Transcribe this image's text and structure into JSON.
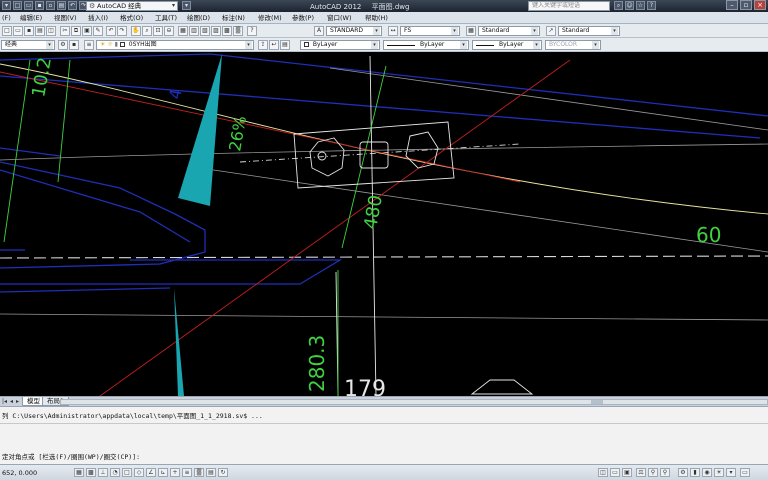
{
  "titlebar": {
    "workspace": "AutoCAD 经典",
    "app_name": "AutoCAD 2012",
    "file_name": "平面图.dwg",
    "search_placeholder": "键入关键字或短语"
  },
  "menu": {
    "items": [
      "(F)",
      "编辑(E)",
      "视图(V)",
      "插入(I)",
      "格式(O)",
      "工具(T)",
      "绘图(D)",
      "标注(N)",
      "修改(M)",
      "参数(P)",
      "窗口(W)",
      "帮助(H)"
    ]
  },
  "toolbar1": {
    "text_style": "STANDARD",
    "dim_style": "FS",
    "table_style": "Standard",
    "mleader_style": "Standard"
  },
  "toolbar2": {
    "workspace": "经典",
    "layer": "0SYH出图",
    "color": "ByLayer",
    "linetype": "ByLayer",
    "lineweight": "ByLayer",
    "plotstyle": "BYCOLOR"
  },
  "drawing": {
    "labels": {
      "dim_10": "10.2",
      "dim_260": "26%",
      "dim_4": "4",
      "dim_480": "480",
      "dim_60": "60",
      "dim_280": "280.3",
      "dim_179": "179"
    }
  },
  "tabs": {
    "model": "模型",
    "layout": "布局1"
  },
  "command": {
    "line1": "列 C:\\Users\\Administrator\\appdata\\local\\temp\\平面图_1_1_2918.sv$ ...",
    "line2": "定对角点或 [栏选(F)/圈围(WP)/圈交(CP)]:"
  },
  "status": {
    "coords": "652, 0.000"
  },
  "colors": {
    "canvas": "#000000",
    "green_dim": "#3fd13f",
    "cyan_fill": "#1aa6b0",
    "blue_line": "#1f2fb8",
    "red_line": "#c0201e",
    "white_line": "#e6e6e6",
    "yellow_line": "#e8e6a0"
  }
}
